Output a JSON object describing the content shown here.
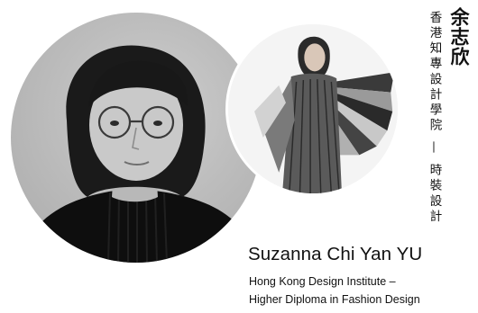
{
  "designer": {
    "chinese_name": "余志欣",
    "chinese_institution": "香港知專設計學院 — 時裝設計",
    "english_name": "Suzanna Chi Yan YU",
    "institution_line1": "Hong Kong Design Institute –",
    "institution_line2": "Higher Diploma in Fashion Design"
  },
  "images": {
    "portrait": "designer-portrait-photo",
    "fashion": "fashion-garment-photo"
  },
  "colors": {
    "text": "#111111",
    "background": "#ffffff",
    "portrait_bg": "#bdbdbd"
  }
}
